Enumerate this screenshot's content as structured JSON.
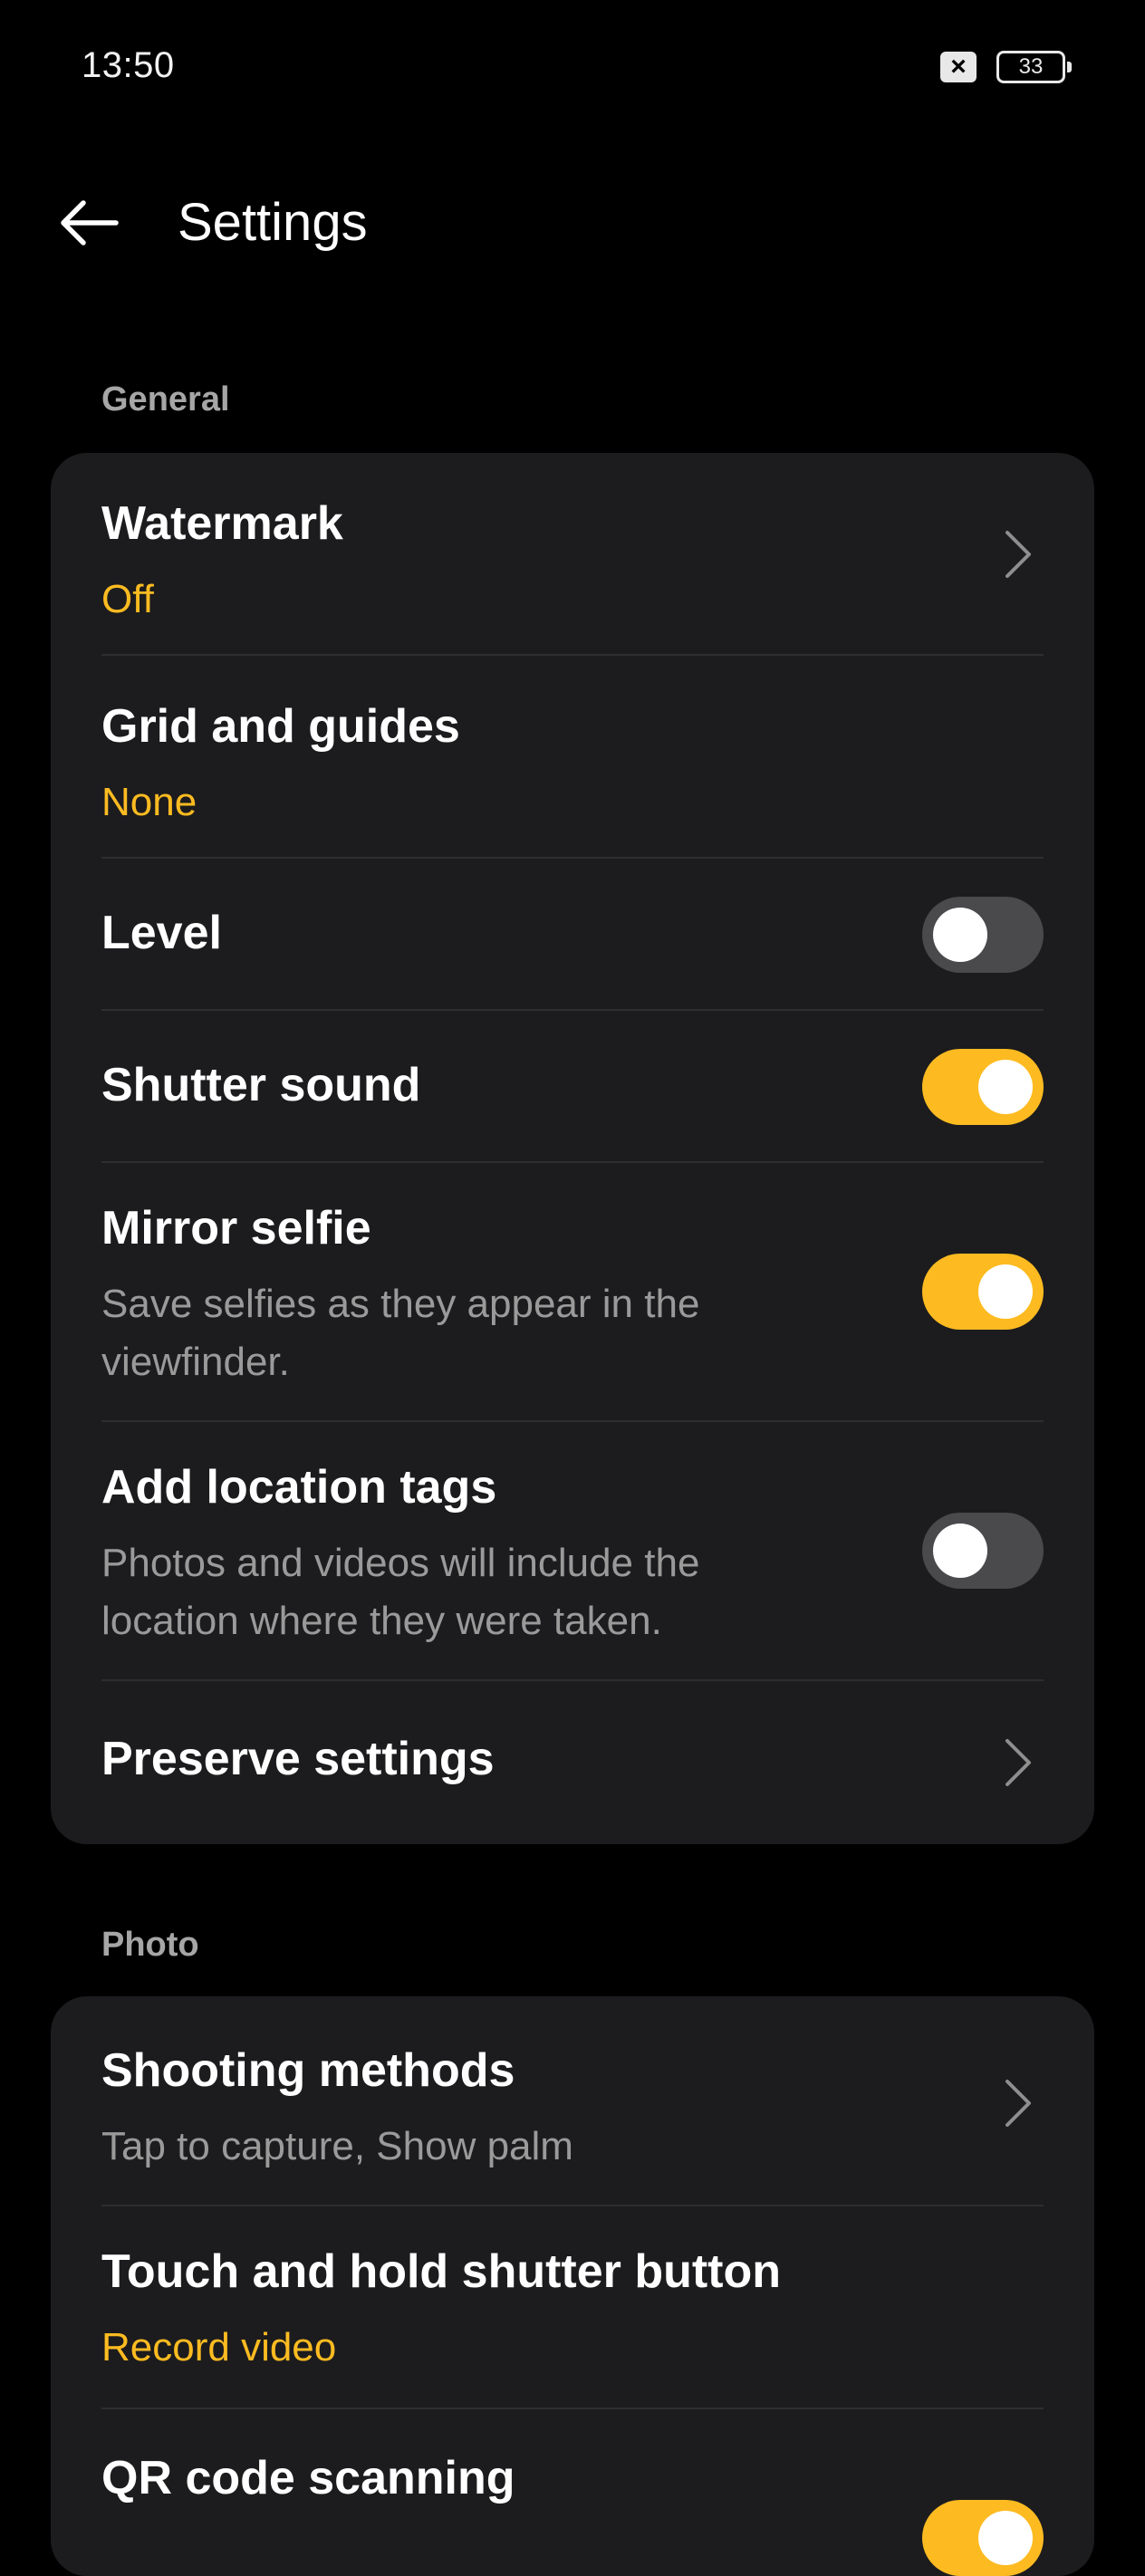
{
  "status_bar": {
    "time": "13:50",
    "sim_icon": "sim-absent-icon",
    "battery_level": "33"
  },
  "app_bar": {
    "back_icon": "back-arrow-icon",
    "title": "Settings"
  },
  "sections": {
    "general": {
      "header": "General",
      "watermark": {
        "title": "Watermark",
        "value": "Off"
      },
      "grid": {
        "title": "Grid and guides",
        "value": "None"
      },
      "level": {
        "title": "Level",
        "enabled": false
      },
      "shutter_sound": {
        "title": "Shutter sound",
        "enabled": true
      },
      "mirror_selfie": {
        "title": "Mirror selfie",
        "desc_line1": "Save selfies as they appear in the",
        "desc_line2": "viewfinder.",
        "enabled": true
      },
      "location_tags": {
        "title": "Add location tags",
        "desc_line1": "Photos and videos will include the",
        "desc_line2": "location where they were taken.",
        "enabled": false
      },
      "preserve": {
        "title": "Preserve settings"
      }
    },
    "photo": {
      "header": "Photo",
      "shooting_methods": {
        "title": "Shooting methods",
        "value": "Tap to capture, Show palm"
      },
      "touch_hold": {
        "title": "Touch and hold shutter button",
        "value": "Record video"
      },
      "qr_scanning": {
        "title": "QR code scanning",
        "enabled": true
      }
    }
  },
  "colors": {
    "accent": "#fdbb21",
    "background": "#000000",
    "card": "#1c1c1e"
  }
}
